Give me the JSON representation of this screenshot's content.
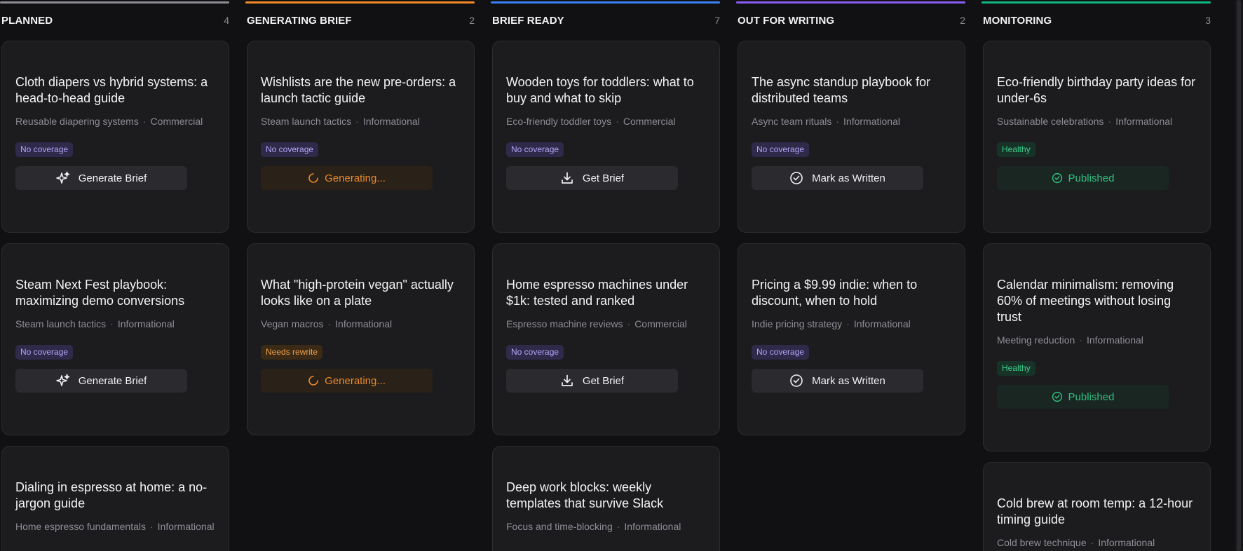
{
  "columns": [
    {
      "title": "PLANNED",
      "count": "4",
      "accent": "#8e8e96",
      "cards": [
        {
          "title": "Cloth diapers vs hybrid systems: a head-to-head guide",
          "topic": "Reusable diapering systems",
          "intent": "Commercial",
          "badge": "No coverage",
          "badge_tone": "violet",
          "action": "Generate Brief",
          "action_tone": "neutral",
          "icon": "sparkle-icon"
        },
        {
          "title": "Steam Next Fest playbook: maximizing demo conversions",
          "topic": "Steam launch tactics",
          "intent": "Informational",
          "badge": "No coverage",
          "badge_tone": "violet",
          "action": "Generate Brief",
          "action_tone": "neutral",
          "icon": "sparkle-icon"
        },
        {
          "title": "Dialing in espresso at home: a no-jargon guide",
          "topic": "Home espresso fundamentals",
          "intent": "Informational"
        }
      ]
    },
    {
      "title": "GENERATING BRIEF",
      "count": "2",
      "accent": "#f08a24",
      "cards": [
        {
          "title": "Wishlists are the new pre-orders: a launch tactic guide",
          "topic": "Steam launch tactics",
          "intent": "Informational",
          "badge": "No coverage",
          "badge_tone": "violet",
          "action": "Generating...",
          "action_tone": "orange",
          "icon": "spinner-icon"
        },
        {
          "title": "What \"high-protein vegan\" actually looks like on a plate",
          "topic": "Vegan macros",
          "intent": "Informational",
          "badge": "Needs rewrite",
          "badge_tone": "orange",
          "action": "Generating...",
          "action_tone": "orange",
          "icon": "spinner-icon"
        }
      ]
    },
    {
      "title": "BRIEF READY",
      "count": "7",
      "accent": "#3b82f6",
      "cards": [
        {
          "title": "Wooden toys for toddlers: what to buy and what to skip",
          "topic": "Eco-friendly toddler toys",
          "intent": "Commercial",
          "badge": "No coverage",
          "badge_tone": "violet",
          "action": "Get Brief",
          "action_tone": "neutral",
          "icon": "download-icon"
        },
        {
          "title": "Home espresso machines under $1k: tested and ranked",
          "topic": "Espresso machine reviews",
          "intent": "Commercial",
          "badge": "No coverage",
          "badge_tone": "violet",
          "action": "Get Brief",
          "action_tone": "neutral",
          "icon": "download-icon"
        },
        {
          "title": "Deep work blocks: weekly templates that survive Slack",
          "topic": "Focus and time-blocking",
          "intent": "Informational"
        }
      ]
    },
    {
      "title": "OUT FOR WRITING",
      "count": "2",
      "accent": "#8b5cf6",
      "cards": [
        {
          "title": "The async standup playbook for distributed teams",
          "topic": "Async team rituals",
          "intent": "Informational",
          "badge": "No coverage",
          "badge_tone": "violet",
          "action": "Mark as Written",
          "action_tone": "neutral",
          "icon": "check-circle-icon"
        },
        {
          "title": "Pricing a $9.99 indie: when to discount, when to hold",
          "topic": "Indie pricing strategy",
          "intent": "Informational",
          "badge": "No coverage",
          "badge_tone": "violet",
          "action": "Mark as Written",
          "action_tone": "neutral",
          "icon": "check-circle-icon"
        }
      ]
    },
    {
      "title": "MONITORING",
      "count": "3",
      "accent": "#10b981",
      "cards": [
        {
          "title": "Eco-friendly birthday party ideas for under-6s",
          "topic": "Sustainable celebrations",
          "intent": "Informational",
          "badge": "Healthy",
          "badge_tone": "green",
          "action": "Published",
          "action_tone": "green",
          "icon": "check-circle-icon"
        },
        {
          "title": "Calendar minimalism: removing 60% of meetings without losing trust",
          "topic": "Meeting reduction",
          "intent": "Informational",
          "badge": "Healthy",
          "badge_tone": "green",
          "action": "Published",
          "action_tone": "green",
          "icon": "check-circle-icon"
        },
        {
          "title": "Cold brew at room temp: a 12-hour timing guide",
          "topic": "Cold brew technique",
          "intent": "Informational"
        }
      ]
    }
  ]
}
